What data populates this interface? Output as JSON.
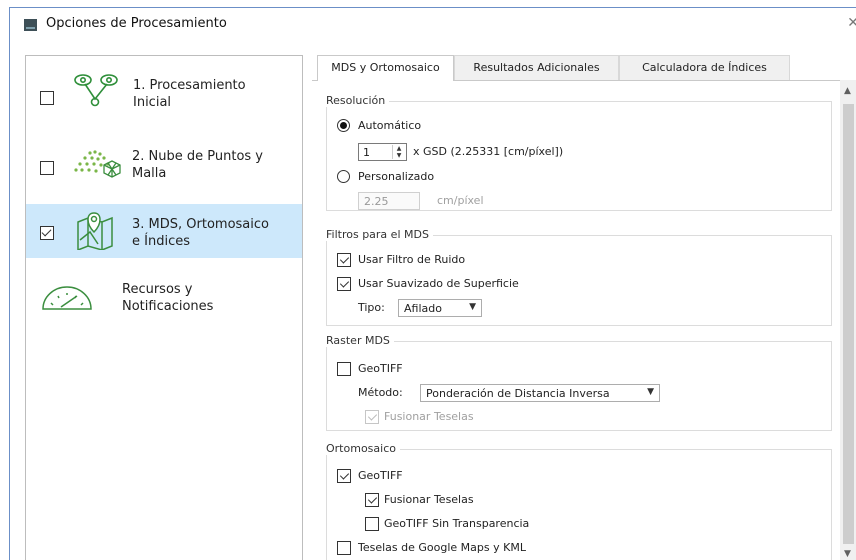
{
  "window": {
    "title": "Opciones de Procesamiento",
    "close_glyph": "✕"
  },
  "sidebar": {
    "items": [
      {
        "line1": "1. Procesamiento",
        "line2": "Inicial",
        "checked": false,
        "active": false,
        "icon": "drone-icon"
      },
      {
        "line1": "2. Nube de Puntos y",
        "line2": "Malla",
        "checked": false,
        "active": false,
        "icon": "point-cloud-icon"
      },
      {
        "line1": "3. MDS, Ortomosaico",
        "line2": "e Índices",
        "checked": true,
        "active": true,
        "icon": "map-pin-icon"
      },
      {
        "line1": "Recursos y",
        "line2": "Notificaciones",
        "checked": null,
        "active": false,
        "icon": "gauge-icon"
      }
    ]
  },
  "tabs": [
    {
      "label": "MDS y Ortomosaico",
      "active": true
    },
    {
      "label": "Resultados Adicionales",
      "active": false
    },
    {
      "label": "Calculadora de Índices",
      "active": false
    }
  ],
  "resolucion": {
    "title": "Resolución",
    "auto_label": "Automático",
    "spin_value": "1",
    "gsd_text": "x GSD (2.25331 [cm/píxel])",
    "custom_label": "Personalizado",
    "custom_value": "2.25",
    "custom_unit": "cm/píxel"
  },
  "filtros": {
    "title": "Filtros para el MDS",
    "noise_label": "Usar Filtro de Ruido",
    "smooth_label": "Usar Suavizado de Superficie",
    "type_label": "Tipo:",
    "type_value": "Afilado"
  },
  "raster": {
    "title": "Raster MDS",
    "geotiff_label": "GeoTIFF",
    "method_label": "Método:",
    "method_value": "Ponderación de Distancia Inversa",
    "merge_label": "Fusionar Teselas"
  },
  "orto": {
    "title": "Ortomosaico",
    "geotiff_label": "GeoTIFF",
    "merge_label": "Fusionar Teselas",
    "no_transp_label": "GeoTIFF Sin Transparencia",
    "google_label": "Teselas de Google Maps y KML"
  },
  "colors": {
    "active_nav": "#cde8fb",
    "window_border": "#6b8fc7"
  }
}
